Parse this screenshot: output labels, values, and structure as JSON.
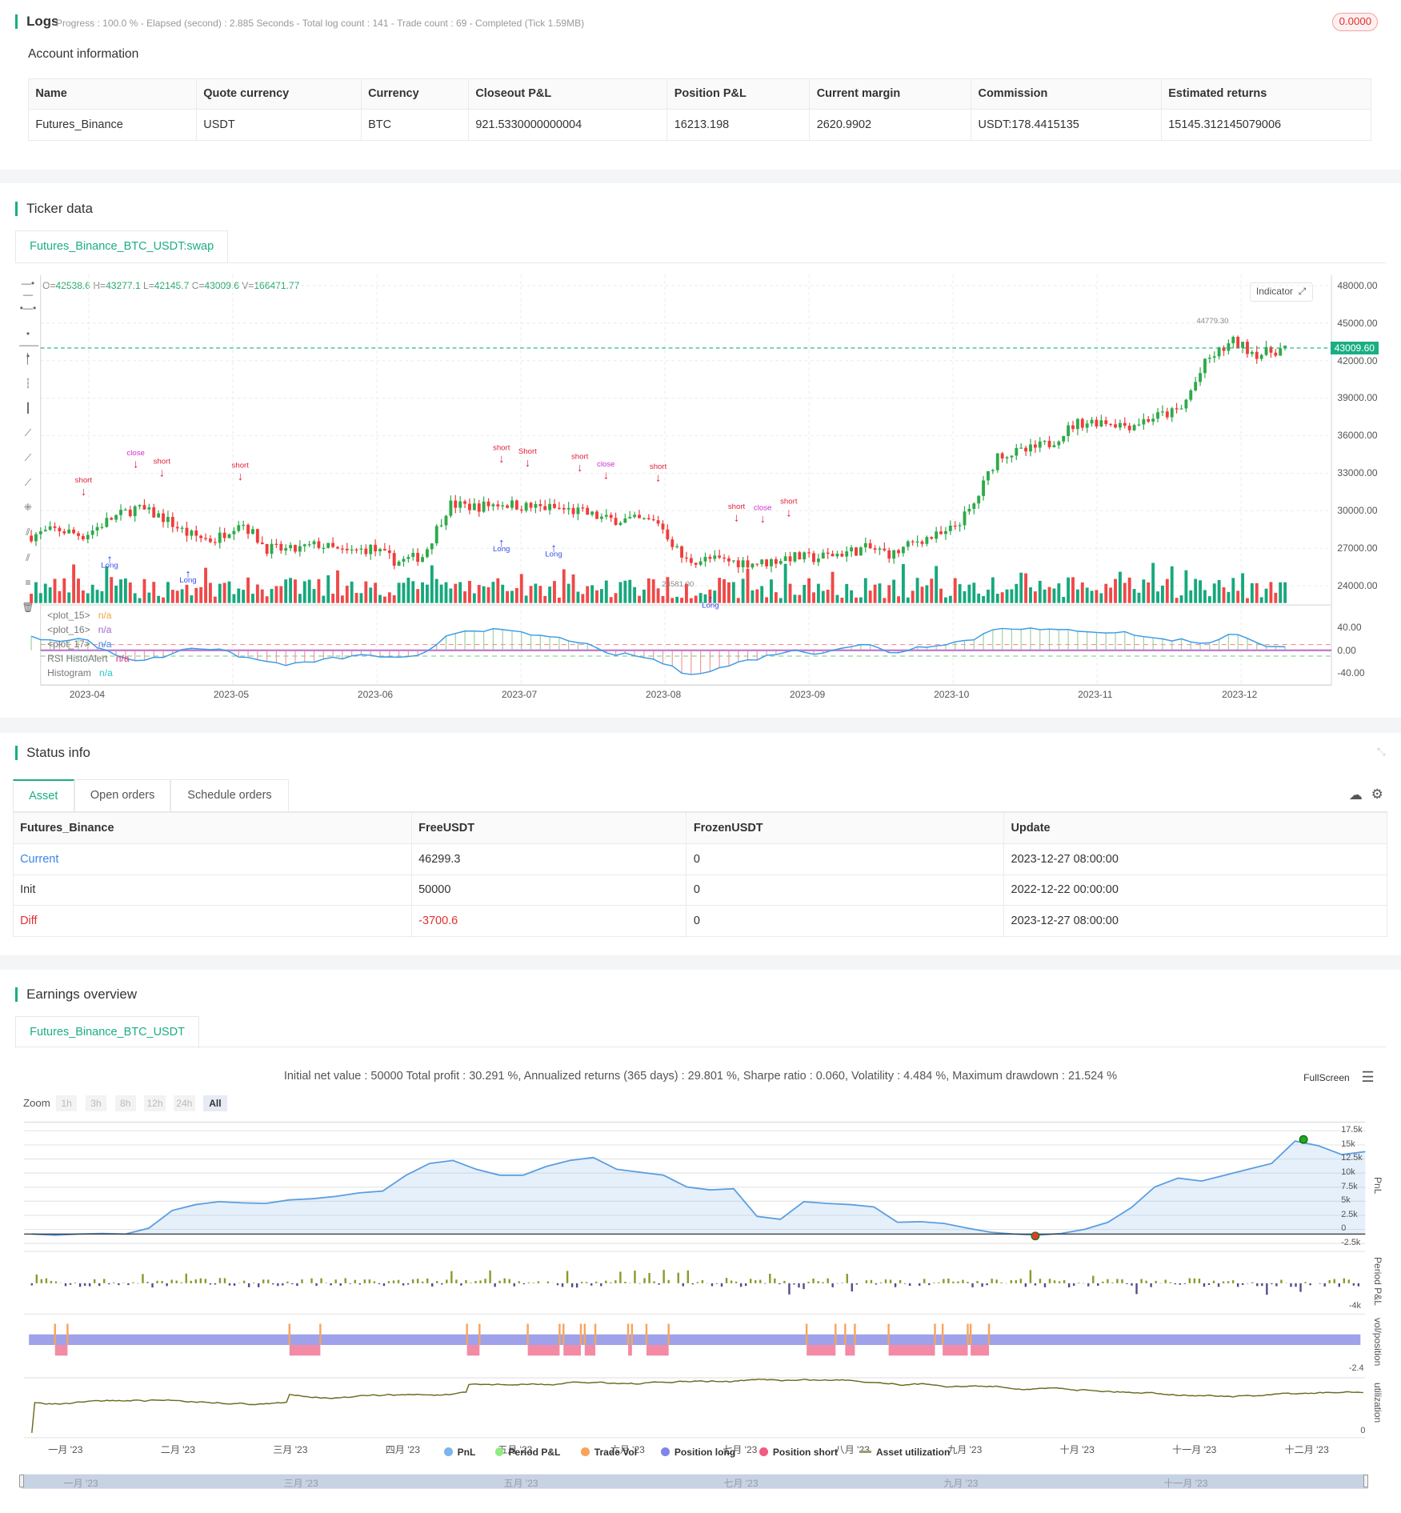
{
  "logs": {
    "title": "Logs",
    "status": "Progress : 100.0 % - Elapsed (second) : 2.885 Seconds - Total log count : 141 - Trade count : 69 - Completed (Tick 1.59MB)",
    "badge": "0.0000"
  },
  "account": {
    "title": "Account information",
    "headers": [
      "Name",
      "Quote currency",
      "Currency",
      "Closeout P&L",
      "Position P&L",
      "Current margin",
      "Commission",
      "Estimated returns"
    ],
    "row": [
      "Futures_Binance",
      "USDT",
      "BTC",
      "921.5330000000004",
      "16213.198",
      "2620.9902",
      "USDT:178.4415135",
      "15145.312145079006"
    ]
  },
  "ticker": {
    "title": "Ticker data",
    "tab": "Futures_Binance_BTC_USDT:swap",
    "ohlc": {
      "o_label": "O=",
      "o": "42538.6",
      "h_label": " H=",
      "h": "43277.1",
      "l_label": " L=",
      "l": "42145.7",
      "c_label": " C=",
      "c": "43009.6",
      "v_label": " V=",
      "v": "166471.77"
    },
    "indicator_button": "Indicator",
    "last_price": "43009.60",
    "high_label": "44779.30",
    "low_label": "24581.00",
    "y_ticks": [
      "48000.00",
      "45000.00",
      "42000.00",
      "39000.00",
      "36000.00",
      "33000.00",
      "30000.00",
      "27000.00",
      "24000.00"
    ],
    "ind_ticks": [
      "40.00",
      "0.00",
      "-40.00"
    ],
    "x_ticks": [
      "2023-04",
      "2023-05",
      "2023-06",
      "2023-07",
      "2023-08",
      "2023-09",
      "2023-10",
      "2023-11",
      "2023-12"
    ],
    "legend": [
      {
        "name": "<plot_15>",
        "val": "n/a",
        "color": "#f7a03b"
      },
      {
        "name": "<plot_16>",
        "val": "n/a",
        "color": "#a368c9"
      },
      {
        "name": "<plot_17>",
        "val": "n/a",
        "color": "#3a86e8"
      },
      {
        "name": "RSI HistoAlert",
        "val": "n/a",
        "color": "#e0306e"
      },
      {
        "name": "Histogram",
        "val": "n/a",
        "color": "#26c6c6"
      }
    ],
    "closes": [
      28000,
      28500,
      28000,
      29300,
      30200,
      29500,
      28100,
      27600,
      29200,
      27000,
      26800,
      27300,
      26600,
      27000,
      25900,
      26400,
      30500,
      30300,
      30600,
      30300,
      30200,
      29900,
      29300,
      29250,
      29100,
      26000,
      26100,
      25900,
      25800,
      26300,
      26200,
      26600,
      27000,
      26500,
      27700,
      28100,
      30100,
      34500,
      34700,
      35400,
      37000,
      37200,
      36800,
      37500,
      38000,
      42000,
      43500,
      42500,
      43000
    ],
    "ind": [
      22,
      18,
      20,
      -5,
      -18,
      -12,
      6,
      2,
      -10,
      -20,
      -25,
      -18,
      -12,
      -8,
      -15,
      -10,
      30,
      36,
      34,
      28,
      22,
      15,
      -6,
      -8,
      -18,
      -40,
      -36,
      -22,
      -12,
      0,
      -5,
      5,
      10,
      -5,
      6,
      12,
      18,
      40,
      38,
      34,
      35,
      32,
      30,
      20,
      18,
      12,
      30,
      10,
      8
    ],
    "markers": [
      {
        "i": 2,
        "t": "short",
        "up": false
      },
      {
        "i": 5,
        "t": "short",
        "up": false
      },
      {
        "i": 8,
        "t": "short",
        "up": false
      },
      {
        "i": 18,
        "t": "short",
        "up": false
      },
      {
        "i": 19,
        "t": "Short",
        "up": false
      },
      {
        "i": 21,
        "t": "short",
        "up": false
      },
      {
        "i": 24,
        "t": "short",
        "up": false
      },
      {
        "i": 27,
        "t": "short",
        "up": false
      },
      {
        "i": 29,
        "t": "short",
        "up": false
      },
      {
        "i": 3,
        "t": "Long",
        "up": true
      },
      {
        "i": 6,
        "t": "Long",
        "up": true
      },
      {
        "i": 18,
        "t": "Long",
        "up": true
      },
      {
        "i": 20,
        "t": "Long",
        "up": true
      },
      {
        "i": 26,
        "t": "Long",
        "up": true
      },
      {
        "i": 4,
        "t": "close",
        "up": false
      },
      {
        "i": 22,
        "t": "close",
        "up": false
      },
      {
        "i": 28,
        "t": "close",
        "up": false
      }
    ]
  },
  "status": {
    "title": "Status info",
    "tabs": [
      "Asset",
      "Open orders",
      "Schedule orders"
    ],
    "headers": [
      "Futures_Binance",
      "FreeUSDT",
      "FrozenUSDT",
      "Update"
    ],
    "rows": [
      [
        "Current",
        "46299.3",
        "0",
        "2023-12-27 08:00:00"
      ],
      [
        "Init",
        "50000",
        "0",
        "2022-12-22 00:00:00"
      ],
      [
        "Diff",
        "-3700.6",
        "0",
        "2023-12-27 08:00:00"
      ]
    ]
  },
  "earnings": {
    "title": "Earnings overview",
    "tab": "Futures_Binance_BTC_USDT",
    "summary": "Initial net value : 50000 Total profit : 30.291 %, Annualized returns (365 days) : 29.801 %, Sharpe ratio : 0.060, Volatility : 4.484 %, Maximum drawdown : 21.524 %",
    "fullscreen": "FullScreen",
    "zoom_label": "Zoom",
    "zoom_buttons": [
      "1h",
      "3h",
      "8h",
      "12h",
      "24h",
      "All"
    ],
    "pnl_ticks": [
      "17.5k",
      "15k",
      "12.5k",
      "10k",
      "7.5k",
      "5k",
      "2.5k",
      "0",
      "-2.5k"
    ],
    "period_tick": "-4k",
    "pos_tick": "-2.4",
    "util_tick": "0",
    "axis_names": [
      "PnL",
      "Period P&L",
      "vol/position",
      "utilization"
    ],
    "months": [
      "一月 '23",
      "二月 '23",
      "三月 '23",
      "四月 '23",
      "五月 '23",
      "六月 '23",
      "七月 '23",
      "八月 '23",
      "九月 '23",
      "十月 '23",
      "十一月 '23",
      "十二月 '23"
    ],
    "nav_months": [
      "一月 '23",
      "三月 '23",
      "五月 '23",
      "七月 '23",
      "九月 '23",
      "十一月 '23"
    ],
    "legend": [
      {
        "name": "PnL",
        "color": "#7cb5ec"
      },
      {
        "name": "Period P&L",
        "color": "#90ed7d"
      },
      {
        "name": "Trade Vol",
        "color": "#f7a35c"
      },
      {
        "name": "Position long",
        "color": "#8085e9"
      },
      {
        "name": "Position short",
        "color": "#f15c80"
      },
      {
        "name": "Asset utilization",
        "color": "#a09b6a"
      }
    ],
    "pnl": [
      0,
      -0.2,
      0,
      0.1,
      0,
      1,
      4,
      5,
      5.5,
      5.3,
      5.2,
      5.8,
      6,
      6.4,
      7,
      7.3,
      10,
      12,
      12.5,
      11,
      10,
      10,
      11.5,
      12.5,
      13,
      11,
      10.5,
      10,
      8,
      7.5,
      7.7,
      3,
      2.5,
      5.5,
      5.2,
      5,
      4.6,
      2,
      2.1,
      1.8,
      1,
      0.3,
      0,
      -0.2,
      0.1,
      0.8,
      2,
      4.5,
      8,
      9.5,
      9,
      10,
      11,
      12,
      15.8,
      15,
      13.5,
      14
    ]
  }
}
